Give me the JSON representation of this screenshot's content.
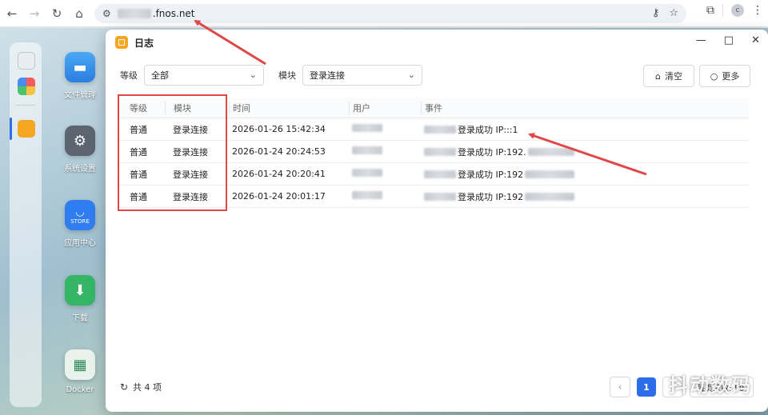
{
  "browser": {
    "url_visible": ".fnos.net",
    "avatar_letter": "c"
  },
  "desktop": {
    "apps": [
      {
        "label": "文件管理"
      },
      {
        "label": "系统设置"
      },
      {
        "label": "应用中心",
        "badge": "STORE"
      },
      {
        "label": "下载"
      },
      {
        "label": "Docker"
      }
    ]
  },
  "window": {
    "title": "日志",
    "filters": {
      "level_label": "等级",
      "level_value": "全部",
      "module_label": "模块",
      "module_value": "登录连接"
    },
    "buttons": {
      "clear": "清空",
      "more": "更多"
    },
    "table": {
      "headers": [
        "等级",
        "模块",
        "时间",
        "用户",
        "事件"
      ],
      "rows": [
        {
          "level": "普通",
          "module": "登录连接",
          "time": "2026-01-26 15:42:34",
          "event": "登录成功 IP:::1"
        },
        {
          "level": "普通",
          "module": "登录连接",
          "time": "2026-01-24 20:24:53",
          "event": "登录成功 IP:192."
        },
        {
          "level": "普通",
          "module": "登录连接",
          "time": "2026-01-24 20:20:41",
          "event": "登录成功 IP:192"
        },
        {
          "level": "普通",
          "module": "登录连接",
          "time": "2026-01-24 20:01:17",
          "event": "登录成功 IP:192"
        }
      ]
    },
    "footer": {
      "total": "共 4 项",
      "current_page": "1",
      "page_size": "每页条数: 50"
    }
  },
  "watermark": "抖动数码",
  "colors": {
    "accent": "#2d6ee8",
    "annotation": "#e04848",
    "logo": "#f5a623"
  }
}
